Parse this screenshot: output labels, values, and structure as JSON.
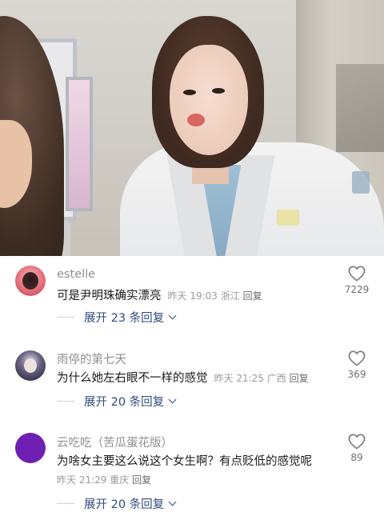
{
  "comments": [
    {
      "username": "estelle",
      "text": "可是尹明珠确实漂亮",
      "time": "昨天 19:03",
      "location": "浙江",
      "reply_label": "回复",
      "expand_label": "展开 23 条回复",
      "likes": "7229"
    },
    {
      "username": "雨停的第七天",
      "text": "为什么她左右眼不一样的感觉",
      "time": "昨天 21:25",
      "location": "广西",
      "reply_label": "回复",
      "expand_label": "展开 20 条回复",
      "likes": "369"
    },
    {
      "username": "云吃吃（苦瓜蛋花版）",
      "text": "为啥女主要这么说这个女生啊？有点贬低的感觉呢",
      "time": "昨天 21:29",
      "location": "重庆",
      "reply_label": "回复",
      "expand_label": "展开 20 条回复",
      "likes": "89"
    }
  ],
  "icons": {
    "like": "heart-outline-icon",
    "expand": "chevron-down-icon"
  },
  "colors": {
    "username": "#8e8e93",
    "expand_link": "#2f4c7e",
    "meta": "#9a9a9f",
    "avatar3": "#6f1fb4"
  }
}
